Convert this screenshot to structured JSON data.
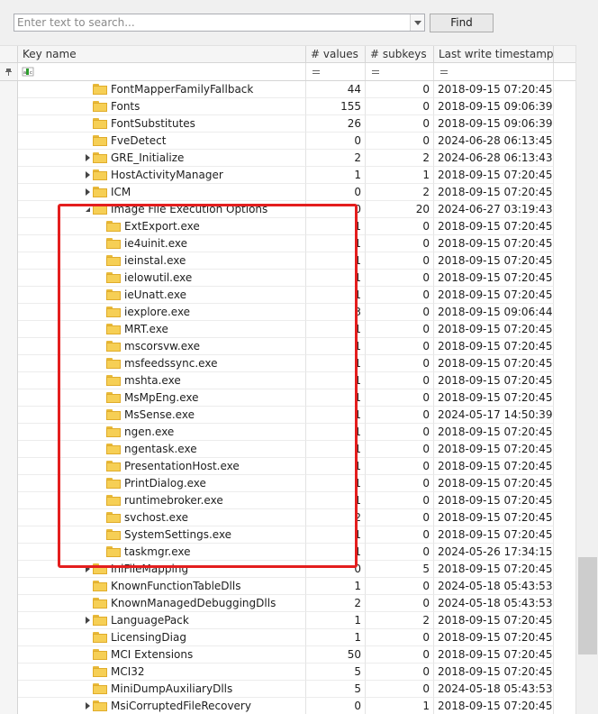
{
  "search": {
    "placeholder": "Enter text to search...",
    "find_label": "Find"
  },
  "columns": {
    "key_name": "Key name",
    "values": "# values",
    "subkeys": "# subkeys",
    "timestamp": "Last write timestamp"
  },
  "filter": {
    "key_name_icon": "abc-filter-icon",
    "values_op": "equals-filter-icon",
    "subkeys_op": "equals-filter-icon",
    "timestamp_op": "equals-filter-icon"
  },
  "colors": {
    "highlight": "#e41e1e",
    "folder": "#f6cf55"
  },
  "rows": [
    {
      "name": "FontMapperFamilyFallback",
      "values": "44",
      "subkeys": "0",
      "ts": "2018-09-15 07:20:45",
      "level": 0,
      "expander": "none"
    },
    {
      "name": "Fonts",
      "values": "155",
      "subkeys": "0",
      "ts": "2018-09-15 09:06:39",
      "level": 0,
      "expander": "none"
    },
    {
      "name": "FontSubstitutes",
      "values": "26",
      "subkeys": "0",
      "ts": "2018-09-15 09:06:39",
      "level": 0,
      "expander": "none"
    },
    {
      "name": "FveDetect",
      "values": "0",
      "subkeys": "0",
      "ts": "2024-06-28 06:13:45",
      "level": 0,
      "expander": "none"
    },
    {
      "name": "GRE_Initialize",
      "values": "2",
      "subkeys": "2",
      "ts": "2024-06-28 06:13:43",
      "level": 0,
      "expander": "closed"
    },
    {
      "name": "HostActivityManager",
      "values": "1",
      "subkeys": "1",
      "ts": "2018-09-15 07:20:45",
      "level": 0,
      "expander": "closed"
    },
    {
      "name": "ICM",
      "values": "0",
      "subkeys": "2",
      "ts": "2018-09-15 07:20:45",
      "level": 0,
      "expander": "closed"
    },
    {
      "name": "Image File Execution Options",
      "values": "0",
      "subkeys": "20",
      "ts": "2024-06-27 03:19:43",
      "level": 0,
      "expander": "open"
    },
    {
      "name": "ExtExport.exe",
      "values": "1",
      "subkeys": "0",
      "ts": "2018-09-15 07:20:45",
      "level": 1,
      "expander": "none"
    },
    {
      "name": "ie4uinit.exe",
      "values": "1",
      "subkeys": "0",
      "ts": "2018-09-15 07:20:45",
      "level": 1,
      "expander": "none"
    },
    {
      "name": "ieinstal.exe",
      "values": "1",
      "subkeys": "0",
      "ts": "2018-09-15 07:20:45",
      "level": 1,
      "expander": "none"
    },
    {
      "name": "ielowutil.exe",
      "values": "1",
      "subkeys": "0",
      "ts": "2018-09-15 07:20:45",
      "level": 1,
      "expander": "none"
    },
    {
      "name": "ieUnatt.exe",
      "values": "1",
      "subkeys": "0",
      "ts": "2018-09-15 07:20:45",
      "level": 1,
      "expander": "none"
    },
    {
      "name": "iexplore.exe",
      "values": "3",
      "subkeys": "0",
      "ts": "2018-09-15 09:06:44",
      "level": 1,
      "expander": "none"
    },
    {
      "name": "MRT.exe",
      "values": "1",
      "subkeys": "0",
      "ts": "2018-09-15 07:20:45",
      "level": 1,
      "expander": "none"
    },
    {
      "name": "mscorsvw.exe",
      "values": "1",
      "subkeys": "0",
      "ts": "2018-09-15 07:20:45",
      "level": 1,
      "expander": "none"
    },
    {
      "name": "msfeedssync.exe",
      "values": "1",
      "subkeys": "0",
      "ts": "2018-09-15 07:20:45",
      "level": 1,
      "expander": "none"
    },
    {
      "name": "mshta.exe",
      "values": "1",
      "subkeys": "0",
      "ts": "2018-09-15 07:20:45",
      "level": 1,
      "expander": "none"
    },
    {
      "name": "MsMpEng.exe",
      "values": "1",
      "subkeys": "0",
      "ts": "2018-09-15 07:20:45",
      "level": 1,
      "expander": "none"
    },
    {
      "name": "MsSense.exe",
      "values": "1",
      "subkeys": "0",
      "ts": "2024-05-17 14:50:39",
      "level": 1,
      "expander": "none"
    },
    {
      "name": "ngen.exe",
      "values": "1",
      "subkeys": "0",
      "ts": "2018-09-15 07:20:45",
      "level": 1,
      "expander": "none"
    },
    {
      "name": "ngentask.exe",
      "values": "1",
      "subkeys": "0",
      "ts": "2018-09-15 07:20:45",
      "level": 1,
      "expander": "none"
    },
    {
      "name": "PresentationHost.exe",
      "values": "1",
      "subkeys": "0",
      "ts": "2018-09-15 07:20:45",
      "level": 1,
      "expander": "none"
    },
    {
      "name": "PrintDialog.exe",
      "values": "1",
      "subkeys": "0",
      "ts": "2018-09-15 07:20:45",
      "level": 1,
      "expander": "none"
    },
    {
      "name": "runtimebroker.exe",
      "values": "1",
      "subkeys": "0",
      "ts": "2018-09-15 07:20:45",
      "level": 1,
      "expander": "none"
    },
    {
      "name": "svchost.exe",
      "values": "2",
      "subkeys": "0",
      "ts": "2018-09-15 07:20:45",
      "level": 1,
      "expander": "none"
    },
    {
      "name": "SystemSettings.exe",
      "values": "1",
      "subkeys": "0",
      "ts": "2018-09-15 07:20:45",
      "level": 1,
      "expander": "none"
    },
    {
      "name": "taskmgr.exe",
      "values": "1",
      "subkeys": "0",
      "ts": "2024-05-26 17:34:15",
      "level": 1,
      "expander": "none"
    },
    {
      "name": "IniFileMapping",
      "values": "0",
      "subkeys": "5",
      "ts": "2018-09-15 07:20:45",
      "level": 0,
      "expander": "closed"
    },
    {
      "name": "KnownFunctionTableDlls",
      "values": "1",
      "subkeys": "0",
      "ts": "2024-05-18 05:43:53",
      "level": 0,
      "expander": "none"
    },
    {
      "name": "KnownManagedDebuggingDlls",
      "values": "2",
      "subkeys": "0",
      "ts": "2024-05-18 05:43:53",
      "level": 0,
      "expander": "none"
    },
    {
      "name": "LanguagePack",
      "values": "1",
      "subkeys": "2",
      "ts": "2018-09-15 07:20:45",
      "level": 0,
      "expander": "closed"
    },
    {
      "name": "LicensingDiag",
      "values": "1",
      "subkeys": "0",
      "ts": "2018-09-15 07:20:45",
      "level": 0,
      "expander": "none"
    },
    {
      "name": "MCI Extensions",
      "values": "50",
      "subkeys": "0",
      "ts": "2018-09-15 07:20:45",
      "level": 0,
      "expander": "none"
    },
    {
      "name": "MCI32",
      "values": "5",
      "subkeys": "0",
      "ts": "2018-09-15 07:20:45",
      "level": 0,
      "expander": "none"
    },
    {
      "name": "MiniDumpAuxiliaryDlls",
      "values": "5",
      "subkeys": "0",
      "ts": "2024-05-18 05:43:53",
      "level": 0,
      "expander": "none"
    },
    {
      "name": "MsiCorruptedFileRecovery",
      "values": "0",
      "subkeys": "1",
      "ts": "2018-09-15 07:20:45",
      "level": 0,
      "expander": "closed"
    }
  ]
}
